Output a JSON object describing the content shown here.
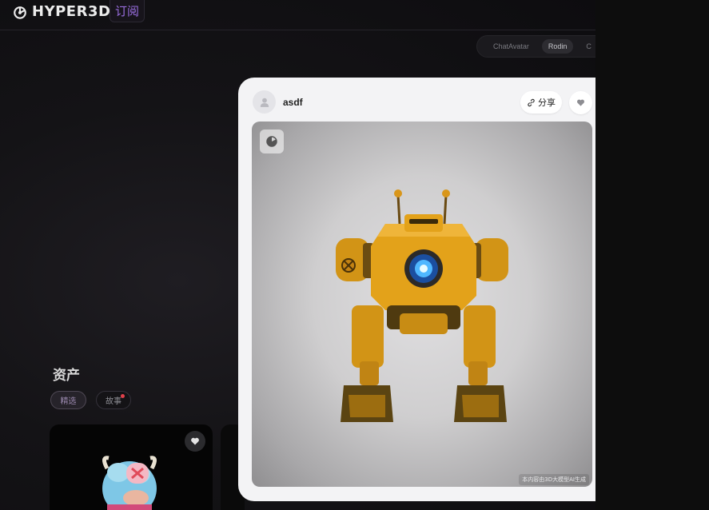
{
  "header": {
    "logo_text": "HYPER3D",
    "subscribe_label": "订阅"
  },
  "tabs": [
    {
      "label": "ChatAvatar",
      "active": false
    },
    {
      "label": "Rodin",
      "active": true
    },
    {
      "label": "C",
      "active": false
    }
  ],
  "assets": {
    "title": "资产",
    "filters": [
      {
        "label": "精选",
        "selected": true
      },
      {
        "label": "故事",
        "has_badge": true
      }
    ]
  },
  "modal": {
    "username": "asdf",
    "share_label": "分享",
    "disclaimer": "本内容由3D大模型AI生成"
  },
  "colors": {
    "accent_purple": "#9a6ee0",
    "badge_red": "#e0404a",
    "robot_yellow": "#e3a21a"
  }
}
